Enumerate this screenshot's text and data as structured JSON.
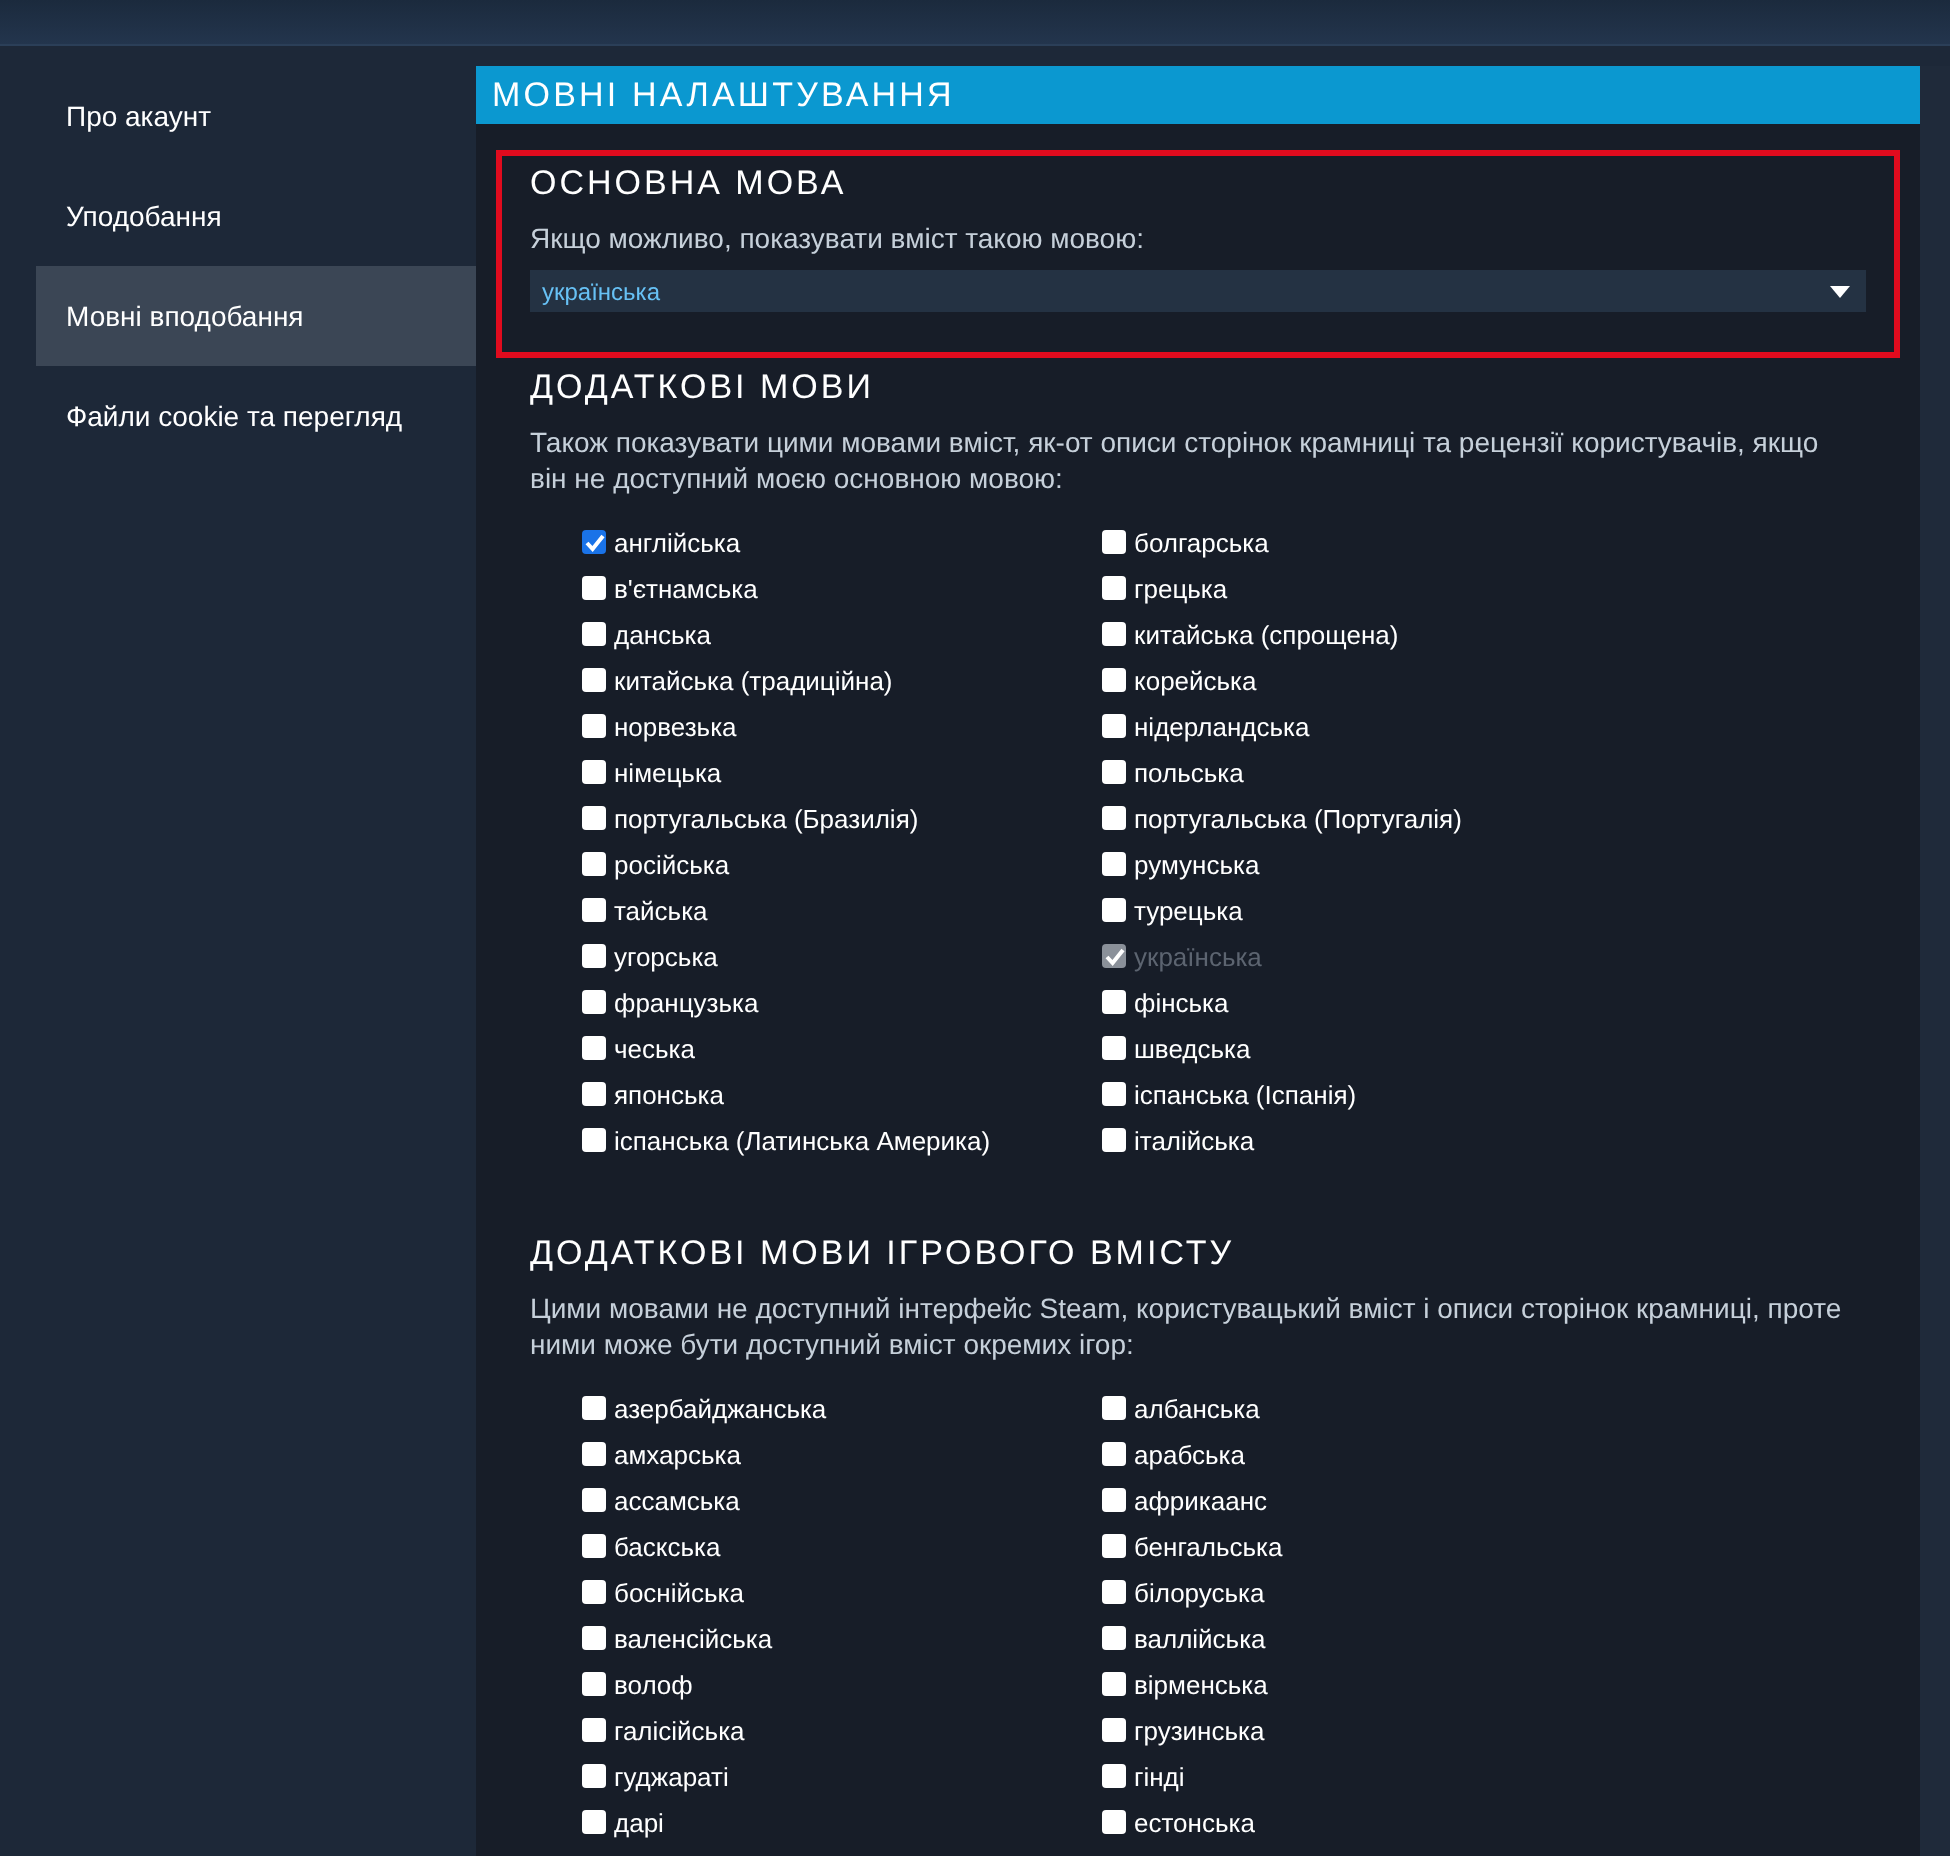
{
  "sidebar": {
    "items": [
      {
        "label": "Про акаунт",
        "selected": false
      },
      {
        "label": "Уподобання",
        "selected": false
      },
      {
        "label": "Мовні вподобання",
        "selected": true
      },
      {
        "label": "Файли cookie та перегляд",
        "selected": false
      }
    ]
  },
  "panel": {
    "title": "МОВНІ НАЛАШТУВАННЯ",
    "sections": [
      {
        "kind": "dropdown",
        "highlighted": true,
        "heading": "ОСНОВНА МОВА",
        "description": "Якщо можливо, показувати вміст такою мовою:",
        "value": "українська"
      },
      {
        "kind": "checklist",
        "heading": "ДОДАТКОВІ МОВИ",
        "description": "Також показувати цими мовами вміст, як-от описи сторінок крамниці та рецензії користувачів, якщо він не доступний моєю основною мовою:",
        "options": [
          {
            "label": "англійська",
            "checked": true,
            "disabled": false
          },
          {
            "label": "болгарська",
            "checked": false,
            "disabled": false
          },
          {
            "label": "в'єтнамська",
            "checked": false,
            "disabled": false
          },
          {
            "label": "грецька",
            "checked": false,
            "disabled": false
          },
          {
            "label": "данська",
            "checked": false,
            "disabled": false
          },
          {
            "label": "китайська (спрощена)",
            "checked": false,
            "disabled": false
          },
          {
            "label": "китайська (традиційна)",
            "checked": false,
            "disabled": false
          },
          {
            "label": "корейська",
            "checked": false,
            "disabled": false
          },
          {
            "label": "норвезька",
            "checked": false,
            "disabled": false
          },
          {
            "label": "нідерландська",
            "checked": false,
            "disabled": false
          },
          {
            "label": "німецька",
            "checked": false,
            "disabled": false
          },
          {
            "label": "польська",
            "checked": false,
            "disabled": false
          },
          {
            "label": "португальська (Бразилія)",
            "checked": false,
            "disabled": false
          },
          {
            "label": "португальська (Португалія)",
            "checked": false,
            "disabled": false
          },
          {
            "label": "російська",
            "checked": false,
            "disabled": false
          },
          {
            "label": "румунська",
            "checked": false,
            "disabled": false
          },
          {
            "label": "тайська",
            "checked": false,
            "disabled": false
          },
          {
            "label": "турецька",
            "checked": false,
            "disabled": false
          },
          {
            "label": "угорська",
            "checked": false,
            "disabled": false
          },
          {
            "label": "українська",
            "checked": true,
            "disabled": true
          },
          {
            "label": "французька",
            "checked": false,
            "disabled": false
          },
          {
            "label": "фінська",
            "checked": false,
            "disabled": false
          },
          {
            "label": "чеська",
            "checked": false,
            "disabled": false
          },
          {
            "label": "шведська",
            "checked": false,
            "disabled": false
          },
          {
            "label": "японська",
            "checked": false,
            "disabled": false
          },
          {
            "label": "іспанська (Іспанія)",
            "checked": false,
            "disabled": false
          },
          {
            "label": "іспанська (Латинська Америка)",
            "checked": false,
            "disabled": false
          },
          {
            "label": "італійська",
            "checked": false,
            "disabled": false
          }
        ]
      },
      {
        "kind": "checklist",
        "heading": "ДОДАТКОВІ МОВИ ІГРОВОГО ВМІСТУ",
        "description": "Цими мовами не доступний інтерфейс Steam, користувацький вміст і описи сторінок крамниці, проте ними може бути доступний вміст окремих ігор:",
        "options": [
          {
            "label": "азербайджанська",
            "checked": false,
            "disabled": false
          },
          {
            "label": "албанська",
            "checked": false,
            "disabled": false
          },
          {
            "label": "амхарська",
            "checked": false,
            "disabled": false
          },
          {
            "label": "арабська",
            "checked": false,
            "disabled": false
          },
          {
            "label": "ассамська",
            "checked": false,
            "disabled": false
          },
          {
            "label": "африкаанс",
            "checked": false,
            "disabled": false
          },
          {
            "label": "баскська",
            "checked": false,
            "disabled": false
          },
          {
            "label": "бенгальська",
            "checked": false,
            "disabled": false
          },
          {
            "label": "боснійська",
            "checked": false,
            "disabled": false
          },
          {
            "label": "білоруська",
            "checked": false,
            "disabled": false
          },
          {
            "label": "валенсійська",
            "checked": false,
            "disabled": false
          },
          {
            "label": "валлійська",
            "checked": false,
            "disabled": false
          },
          {
            "label": "волоф",
            "checked": false,
            "disabled": false
          },
          {
            "label": "вірменська",
            "checked": false,
            "disabled": false
          },
          {
            "label": "галісійська",
            "checked": false,
            "disabled": false
          },
          {
            "label": "грузинська",
            "checked": false,
            "disabled": false
          },
          {
            "label": "гуджараті",
            "checked": false,
            "disabled": false
          },
          {
            "label": "гінді",
            "checked": false,
            "disabled": false
          },
          {
            "label": "дарі",
            "checked": false,
            "disabled": false
          },
          {
            "label": "естонська",
            "checked": false,
            "disabled": false
          }
        ]
      }
    ]
  }
}
